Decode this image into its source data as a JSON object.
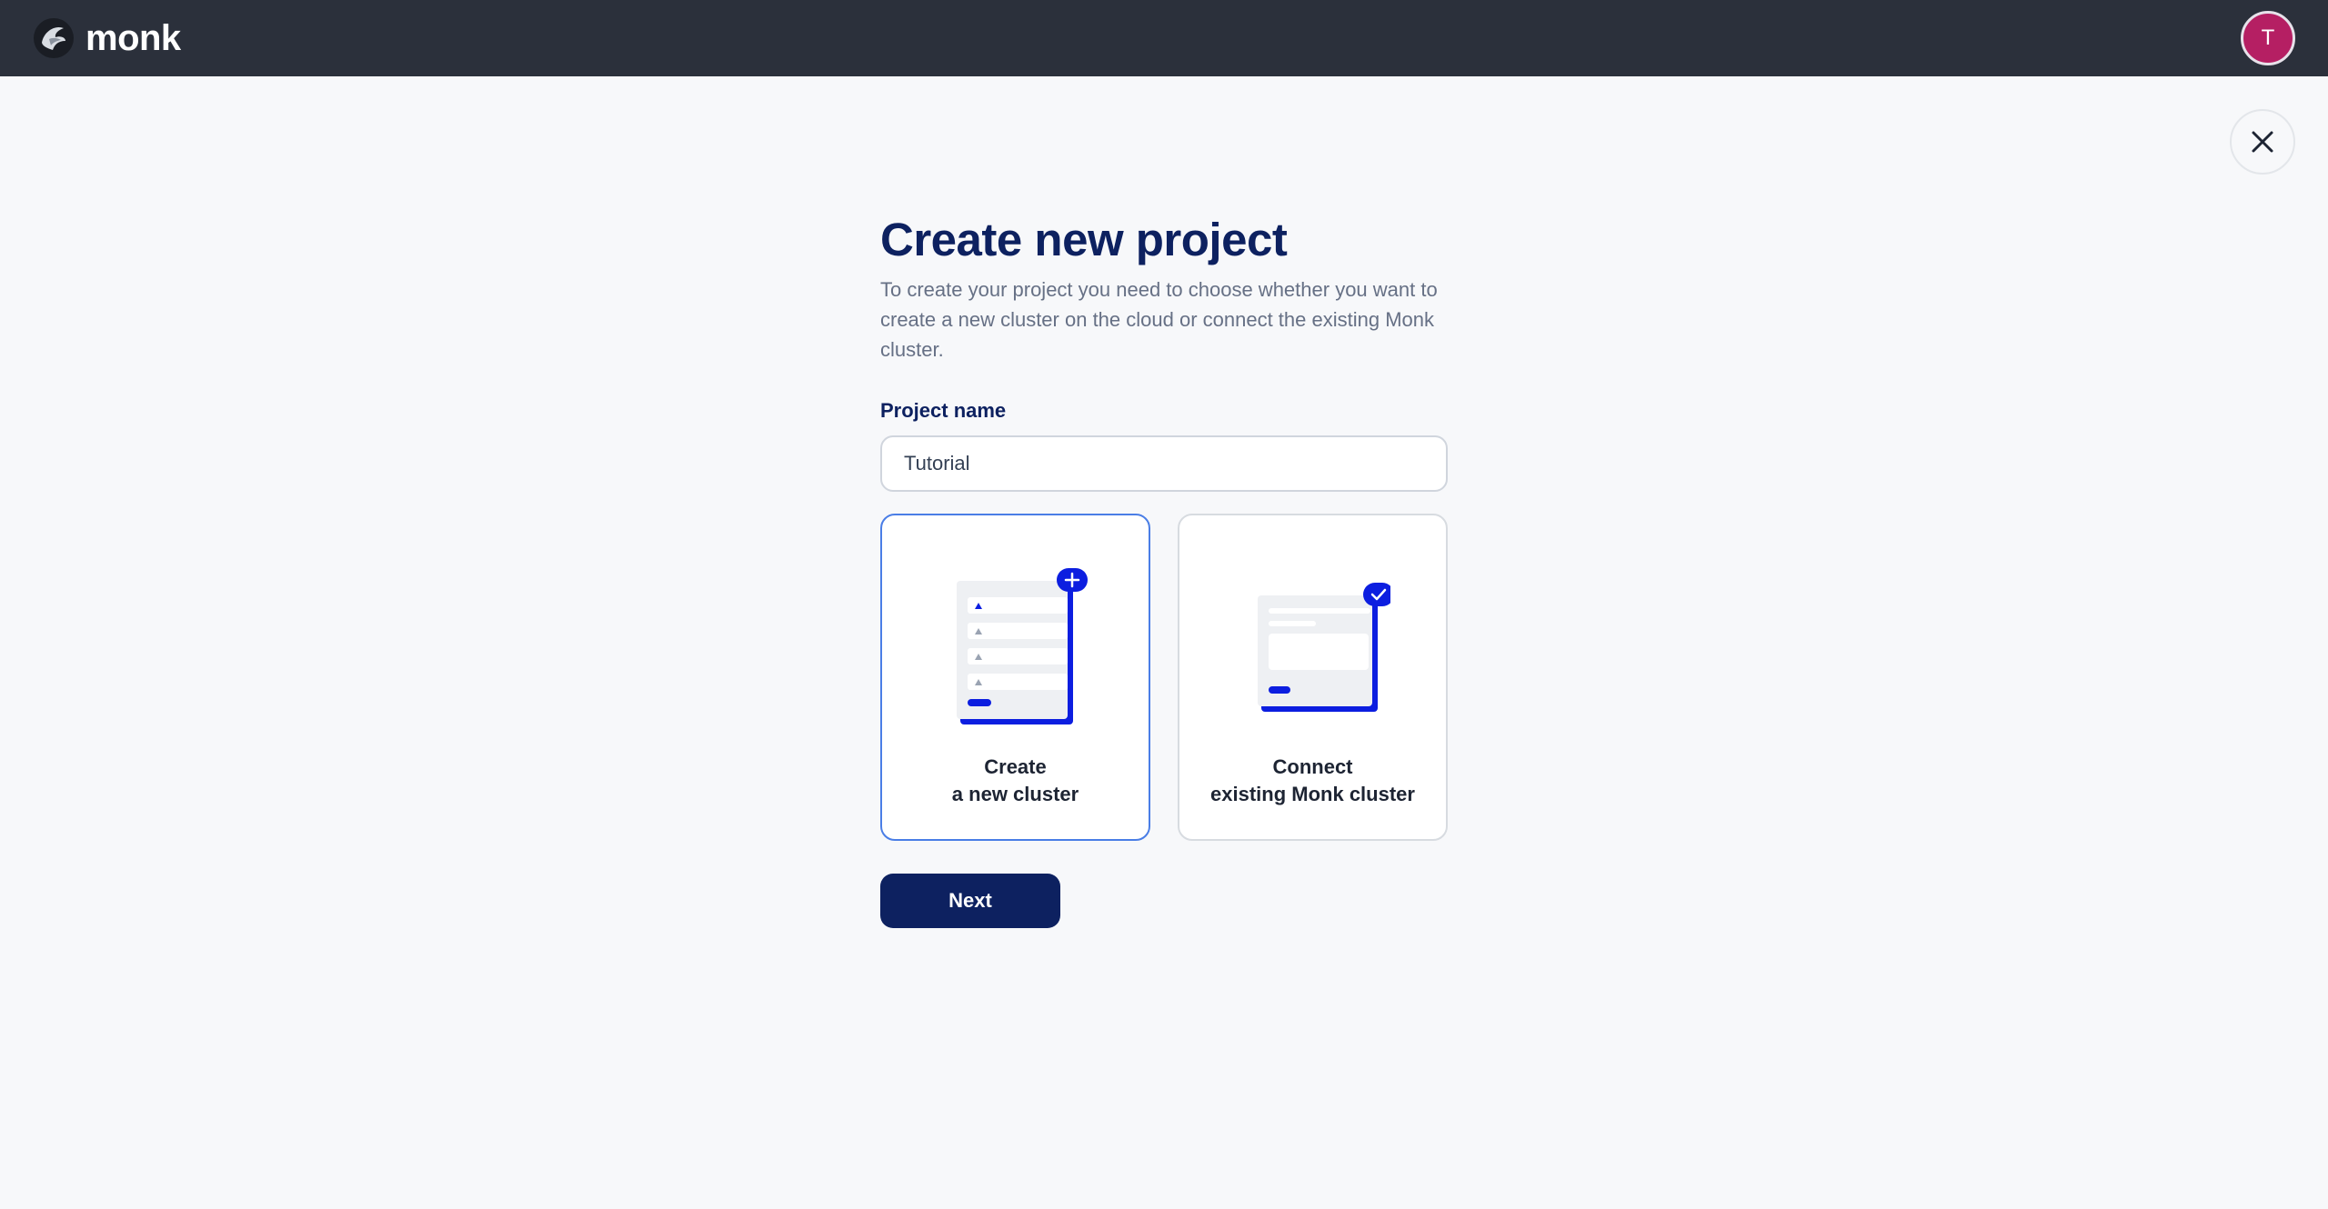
{
  "app": {
    "brand_name": "monk",
    "user_initial": "T",
    "accent_color": "#0d2160",
    "avatar_color": "#b51f63",
    "illustration_blue": "#0c1ee0"
  },
  "dialog": {
    "title": "Create new project",
    "description": "To create your project you need to choose whether you want to create a new cluster on the cloud or connect the existing Monk cluster.",
    "project_name_label": "Project name",
    "project_name_value": "Tutorial",
    "options": [
      {
        "line1": "Create",
        "line2": "a new cluster",
        "icon": "create-cluster-illustration",
        "selected": true
      },
      {
        "line1": "Connect",
        "line2": "existing Monk cluster",
        "icon": "connect-cluster-illustration",
        "selected": false
      }
    ],
    "next_label": "Next"
  }
}
